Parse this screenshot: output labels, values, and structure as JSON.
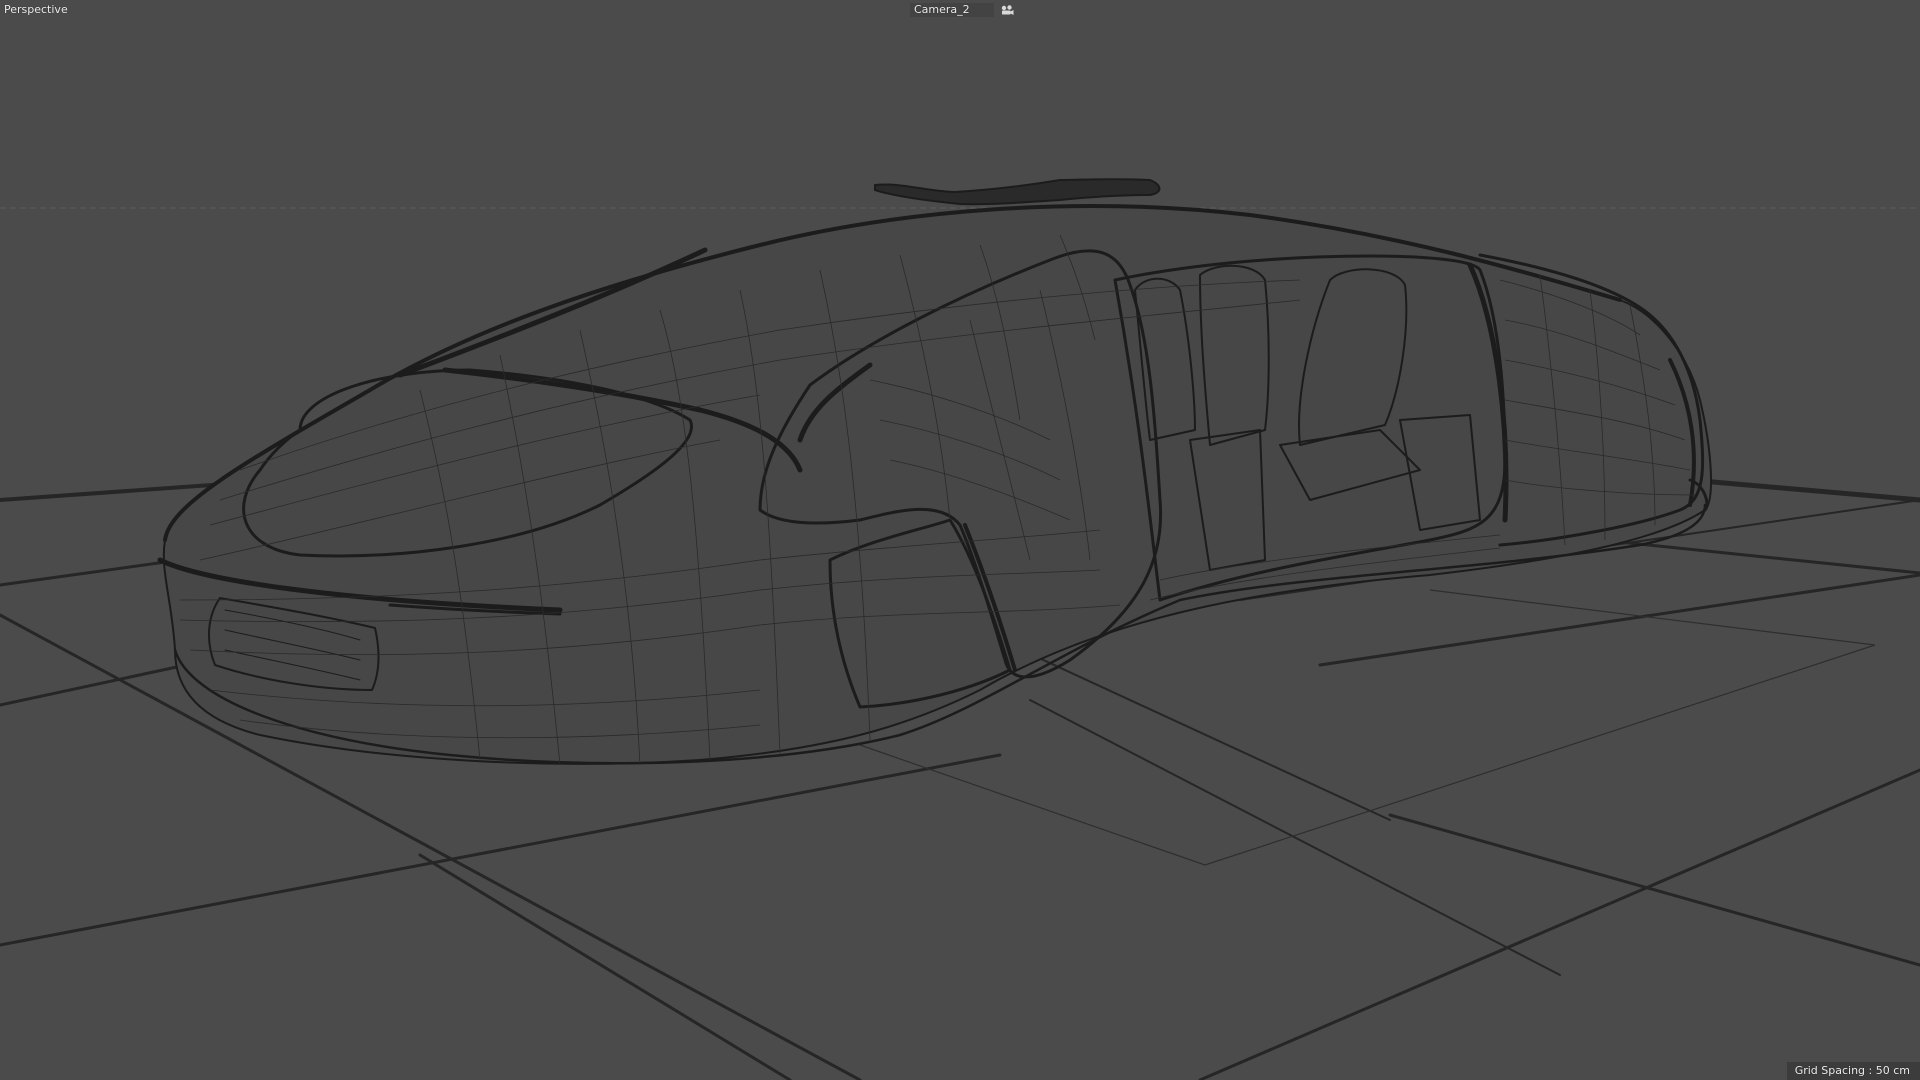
{
  "viewport": {
    "view_name": "Perspective",
    "camera_name": "Camera_2",
    "camera_icon": "camera-target-icon",
    "grid_spacing": "Grid Spacing : 50 cm"
  },
  "colors": {
    "background": "#4b4b4b",
    "wireframe": "#1c1c1c",
    "grid_line": "#262626",
    "text": "#ececec"
  }
}
